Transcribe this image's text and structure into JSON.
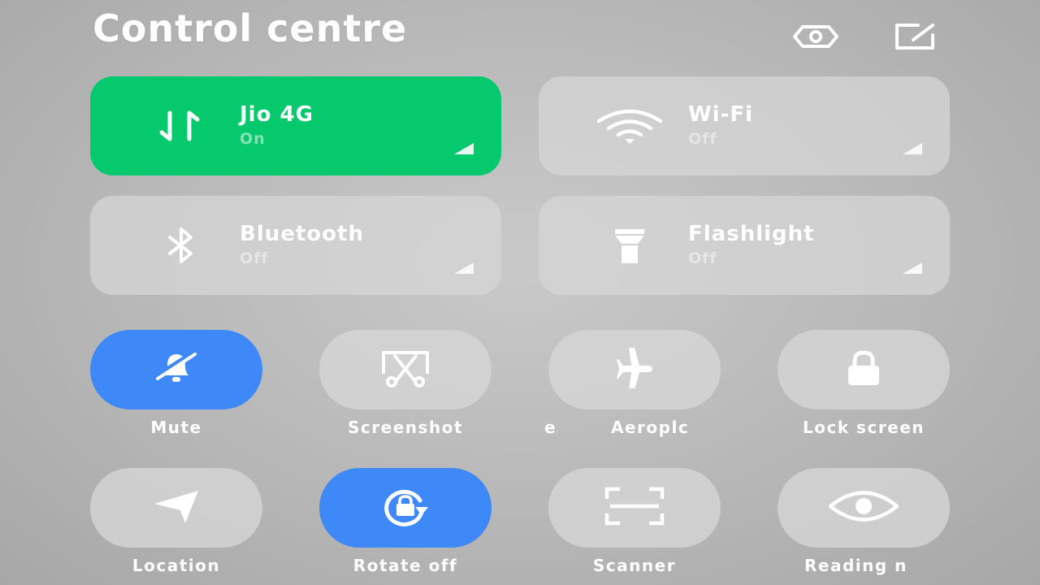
{
  "header": {
    "title": "Control centre",
    "settings_icon": "settings-hex-icon",
    "edit_icon": "edit-icon"
  },
  "tiles": [
    {
      "name": "Jio 4G",
      "state": "On",
      "icon": "mobile-data-icon",
      "active": true
    },
    {
      "name": "Wi-Fi",
      "state": "Off",
      "icon": "wifi-icon",
      "active": false
    },
    {
      "name": "Bluetooth",
      "state": "Off",
      "icon": "bluetooth-icon",
      "active": false
    },
    {
      "name": "Flashlight",
      "state": "Off",
      "icon": "flashlight-icon",
      "active": false
    }
  ],
  "toggles": [
    {
      "label": "Mute",
      "icon": "bell-off-icon",
      "active": true
    },
    {
      "label": "Screenshot",
      "icon": "screenshot-icon",
      "active": false
    },
    {
      "label_prefix": "e",
      "label": "Aeroplc",
      "icon": "airplane-icon",
      "active": false
    },
    {
      "label": "Lock screen",
      "icon": "lock-icon",
      "active": false
    },
    {
      "label": "Location",
      "icon": "location-arrow-icon",
      "active": false
    },
    {
      "label": "Rotate off",
      "icon": "rotate-lock-icon",
      "active": true
    },
    {
      "label": "Scanner",
      "icon": "scanner-icon",
      "active": false
    },
    {
      "label": "Reading n",
      "icon": "eye-icon",
      "active": false
    }
  ],
  "colors": {
    "active_green": "#06c96d",
    "active_blue": "#3e88f8",
    "tile_bg": "#d6d6d6"
  }
}
